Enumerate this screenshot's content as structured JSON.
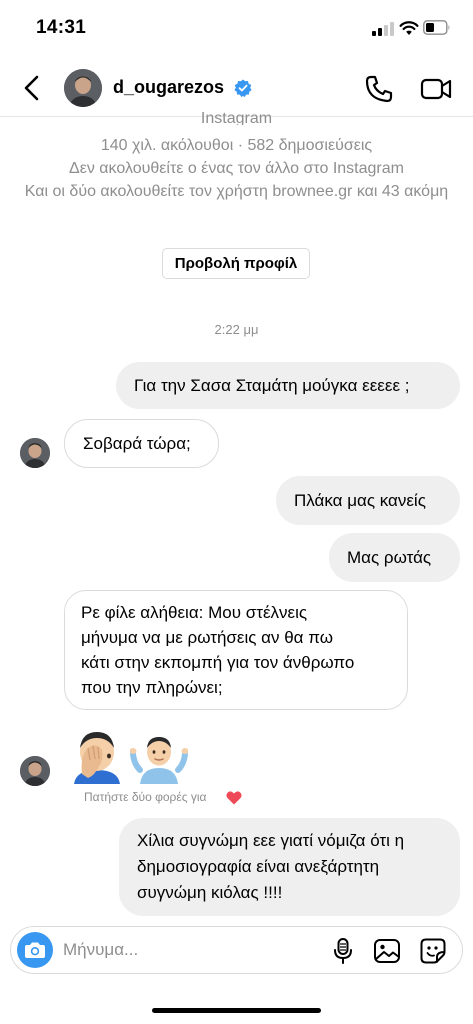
{
  "status_bar": {
    "time": "14:31"
  },
  "header": {
    "username": "d_ougarezos",
    "verified": true
  },
  "profile_info": {
    "source_label": "Instagram",
    "stats": "140 χιλ. ακόλουθοι · 582 δημοσιεύσεις",
    "follow_status": "Δεν ακολουθείτε ο ένας τον άλλο στο Instagram",
    "mutual": "Και οι δύο ακολουθείτε τον χρήστη brownee.gr και 43 ακόμη",
    "view_profile_label": "Προβολή προφίλ"
  },
  "conversation": {
    "timestamp": "2:22 μμ",
    "messages": [
      {
        "direction": "outgoing",
        "text": "Για την Σασα Σταμάτη μούγκα εεεεε ;"
      },
      {
        "direction": "incoming",
        "text": "Σοβαρά τώρα;"
      },
      {
        "direction": "outgoing",
        "text": "Πλάκα μας κανείς"
      },
      {
        "direction": "outgoing",
        "text": "Μας ρωτάς"
      },
      {
        "direction": "incoming",
        "lines": [
          "Ρε φίλε αλήθεια: Μου στέλνεις",
          "μήνυμα να με ρωτήσεις αν θα πω",
          "κάτι στην εκπομπή για τον άνθρωπο",
          "που την πληρώνει;"
        ]
      },
      {
        "direction": "incoming",
        "emoji": [
          "face-palm",
          "shrug"
        ]
      },
      {
        "direction": "outgoing",
        "lines": [
          "Χίλια συγνώμη εεε γιατί νόμιζα ότι η",
          "δημοσιογραφία είναι ανεξάρτητη",
          "συγνώμη κιόλας !!!!"
        ]
      }
    ],
    "double_tap_hint": "Πατήστε δύο φορές για"
  },
  "composer": {
    "placeholder": "Μήνυμα..."
  },
  "colors": {
    "accent": "#3897f0",
    "verified": "#3897f0",
    "bubble_out": "#efefef",
    "border": "#dbdbdb",
    "muted": "#8e8e8e",
    "heart": "#ed4956"
  }
}
